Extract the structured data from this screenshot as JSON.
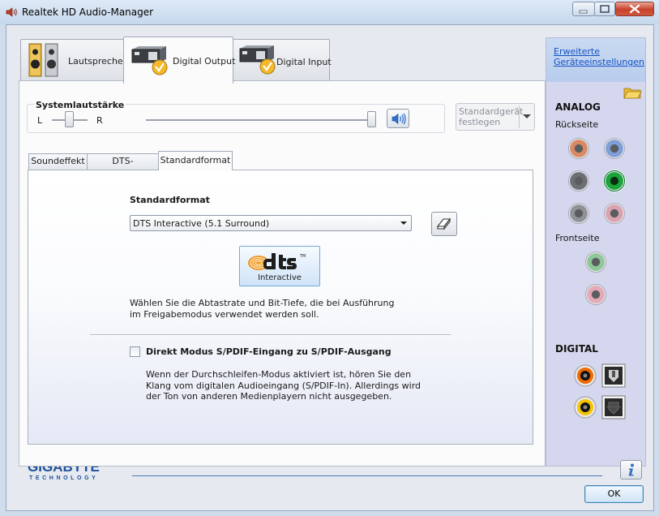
{
  "window": {
    "title": "Realtek HD Audio-Manager"
  },
  "tabs": [
    {
      "label": "Lautsprecher",
      "active": false
    },
    {
      "label": "Digital Output",
      "active": true
    },
    {
      "label": "Digital Input",
      "active": false
    }
  ],
  "volume": {
    "title": "Systemlautstärke",
    "left_label": "L",
    "right_label": "R",
    "balance_percent": 50,
    "level_percent": 100
  },
  "default_device_button": "Standardgerät festlegen",
  "sub_tabs": [
    {
      "label": "Soundeffekt",
      "active": false
    },
    {
      "label": "DTS-Verbindung",
      "active": false
    },
    {
      "label": "Standardformat",
      "active": true
    }
  ],
  "standard_format": {
    "heading": "Standardformat",
    "selected": "DTS Interactive (5.1 Surround)",
    "logo_sub": "Interactive",
    "description": "Wählen Sie die Abtastrate und Bit-Tiefe, die bei Ausführung im Freigabemodus verwendet werden soll.",
    "checkbox_label": "Direkt Modus S/PDIF-Eingang zu S/PDIF-Ausgang",
    "checkbox_checked": false,
    "passthrough_description": "Wenn der Durchschleifen-Modus aktiviert ist, hören Sie den Klang vom digitalen Audioeingang (S/PDIF-In). Allerdings wird der Ton von anderen Medienplayern nicht ausgegeben."
  },
  "right_panel": {
    "advanced_link": "Erweiterte Geräteeinstellungen",
    "analog_title": "ANALOG",
    "rear_label": "Rückseite",
    "front_label": "Frontseite",
    "digital_title": "DIGITAL",
    "rear_jacks": [
      {
        "name": "orange",
        "color": "#d98a62",
        "plugged": false
      },
      {
        "name": "blue",
        "color": "#7f9fd6",
        "plugged": false
      },
      {
        "name": "black",
        "color": "#6c6f73",
        "plugged": false
      },
      {
        "name": "green",
        "color": "#19a53a",
        "plugged": true
      },
      {
        "name": "grey",
        "color": "#8f9296",
        "plugged": false
      },
      {
        "name": "pink",
        "color": "#d9a2ae",
        "plugged": false
      }
    ],
    "front_jacks": [
      {
        "name": "green",
        "color": "#8fc79b",
        "plugged": false
      },
      {
        "name": "pink",
        "color": "#e4aab6",
        "plugged": false
      }
    ]
  },
  "footer": {
    "brand": "GIGABYTE",
    "brand_sub": "TECHNOLOGY",
    "ok_label": "OK"
  },
  "colors": {
    "link": "#1451c4",
    "brand_blue": "#1d4f9a",
    "accent_border": "#3c7fb1"
  }
}
